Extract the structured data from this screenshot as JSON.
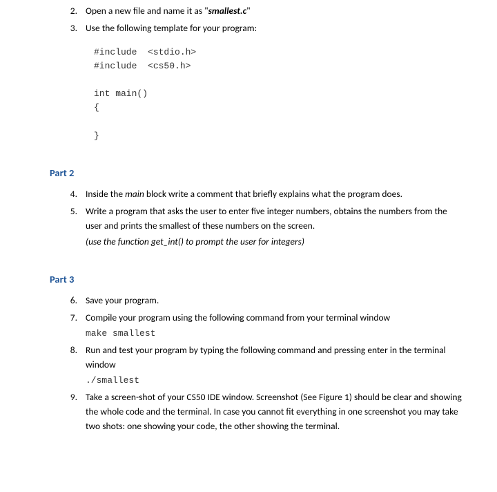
{
  "top_items": [
    {
      "num": "2.",
      "text_prefix": "Open a new file and name it as \"",
      "em": "smallest.c",
      "text_suffix": "\""
    },
    {
      "num": "3.",
      "text": "Use the following template for your program:"
    }
  ],
  "code_template": "#include  <stdio.h>\n#include  <cs50.h>\n\nint main()\n{\n\n}",
  "part2": {
    "heading": "Part 2",
    "items": [
      {
        "num": "4.",
        "text_prefix": "Inside the ",
        "em": "main",
        "text_suffix": " block write a comment that briefly explains what the program does."
      },
      {
        "num": "5.",
        "text": "Write a program that asks the user to enter five integer numbers, obtains the numbers from the user and prints the smallest of these numbers on the screen.",
        "hint": "(use the function get_int() to prompt the user for integers)"
      }
    ]
  },
  "part3": {
    "heading": "Part 3",
    "items": [
      {
        "num": "6.",
        "text": "Save your program."
      },
      {
        "num": "7.",
        "text": "Compile your program using the following command from your terminal window",
        "cmd": "make smallest"
      },
      {
        "num": "8.",
        "text": "Run and test your program by typing the following command and pressing enter in the terminal window",
        "cmd": "./smallest"
      },
      {
        "num": "9.",
        "text": "Take a screen-shot of your CS50 IDE window. Screenshot (See Figure 1) should be clear and showing the whole code and the terminal. In case you cannot fit everything in one screenshot you may take two shots: one showing your code, the other showing the terminal."
      }
    ]
  }
}
